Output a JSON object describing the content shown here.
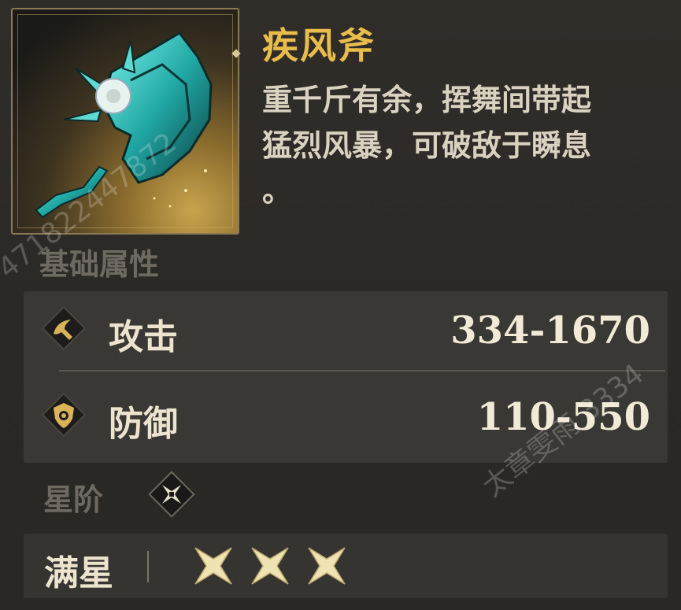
{
  "item": {
    "name": "疾风斧",
    "description_line1": "重千斤有余，挥舞间带起",
    "description_line2": "猛烈风暴，可破敌于瞬息",
    "description_line3": "。"
  },
  "section_title": "基础属性",
  "stats": [
    {
      "label": "攻击",
      "value": "334-1670",
      "icon": "attack-icon"
    },
    {
      "label": "防御",
      "value": "110-550",
      "icon": "defense-icon"
    }
  ],
  "tier": {
    "label": "星阶",
    "icon": "star-tier-icon"
  },
  "full_star": {
    "label": "满星",
    "stars": 3,
    "star_icon": "star-icon"
  },
  "watermarks": {
    "left": "471822447872",
    "right": "太章雯雨 3334"
  },
  "colors": {
    "title": "#e9bd4c",
    "accent_gold": "#d9c48a",
    "weapon_teal": "#38c9c2"
  }
}
